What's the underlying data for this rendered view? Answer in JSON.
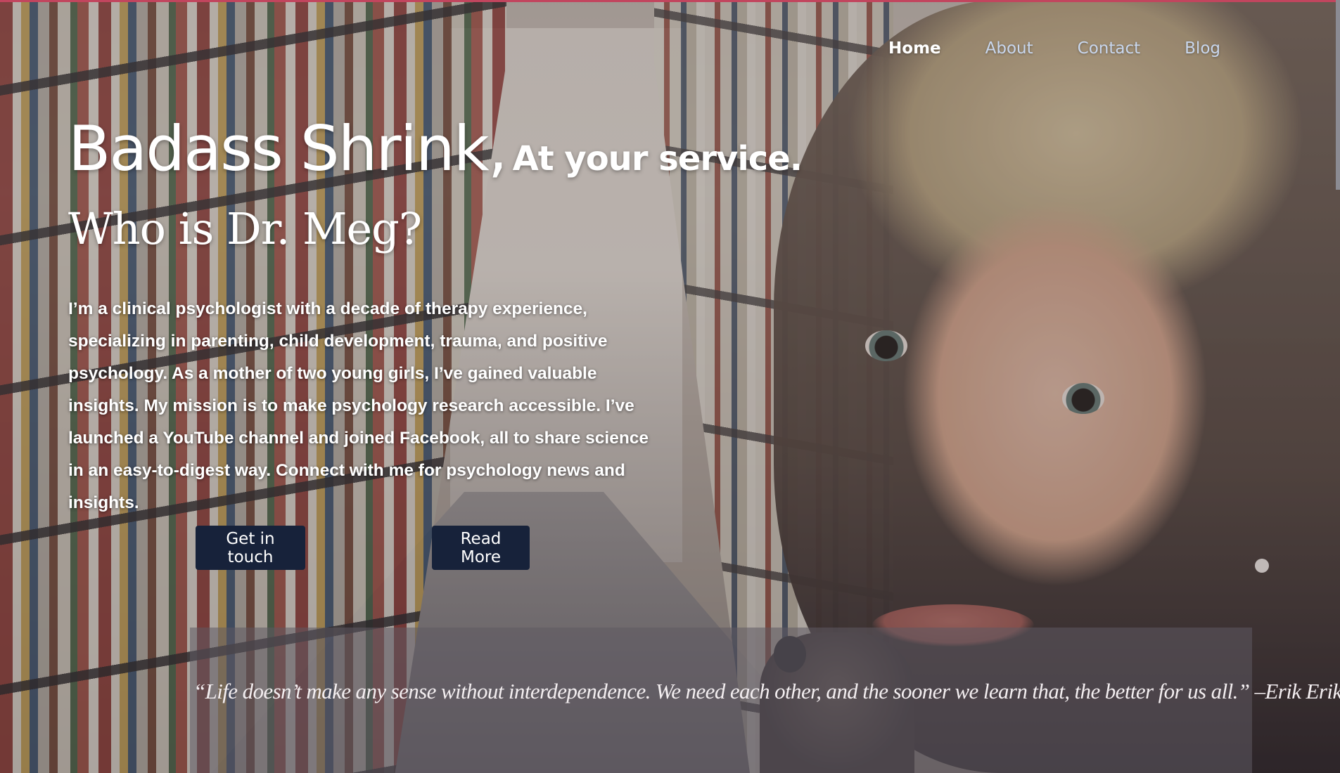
{
  "nav": {
    "items": [
      "Home",
      "About",
      "Contact",
      "Blog"
    ],
    "active": "Home"
  },
  "hero": {
    "title_main": "Badass Shrink,",
    "title_tail": "At your service.",
    "subtitle": "Who is Dr. Meg?",
    "bio": "I’m a clinical psychologist with a decade of therapy experience, specializing in parenting, child development, trauma, and positive psychology. As a mother of two young girls, I’ve gained valuable insights. My mission is to make psychology research accessible. I’ve launched a YouTube channel and joined Facebook, all to share science in an easy-to-digest way. Connect with me for psychology news and insights."
  },
  "buttons": {
    "get_in_touch": "Get in touch",
    "read_more": "Read More"
  },
  "quote": {
    "text": "“Life doesn’t make any sense without interdependence. We need each other, and the sooner we learn that, the better for us all.” –Erik Erikson"
  },
  "colors": {
    "button_bg": "#17223a",
    "nav_link": "#c9d7ee",
    "accent_bar": "#c2455e"
  }
}
